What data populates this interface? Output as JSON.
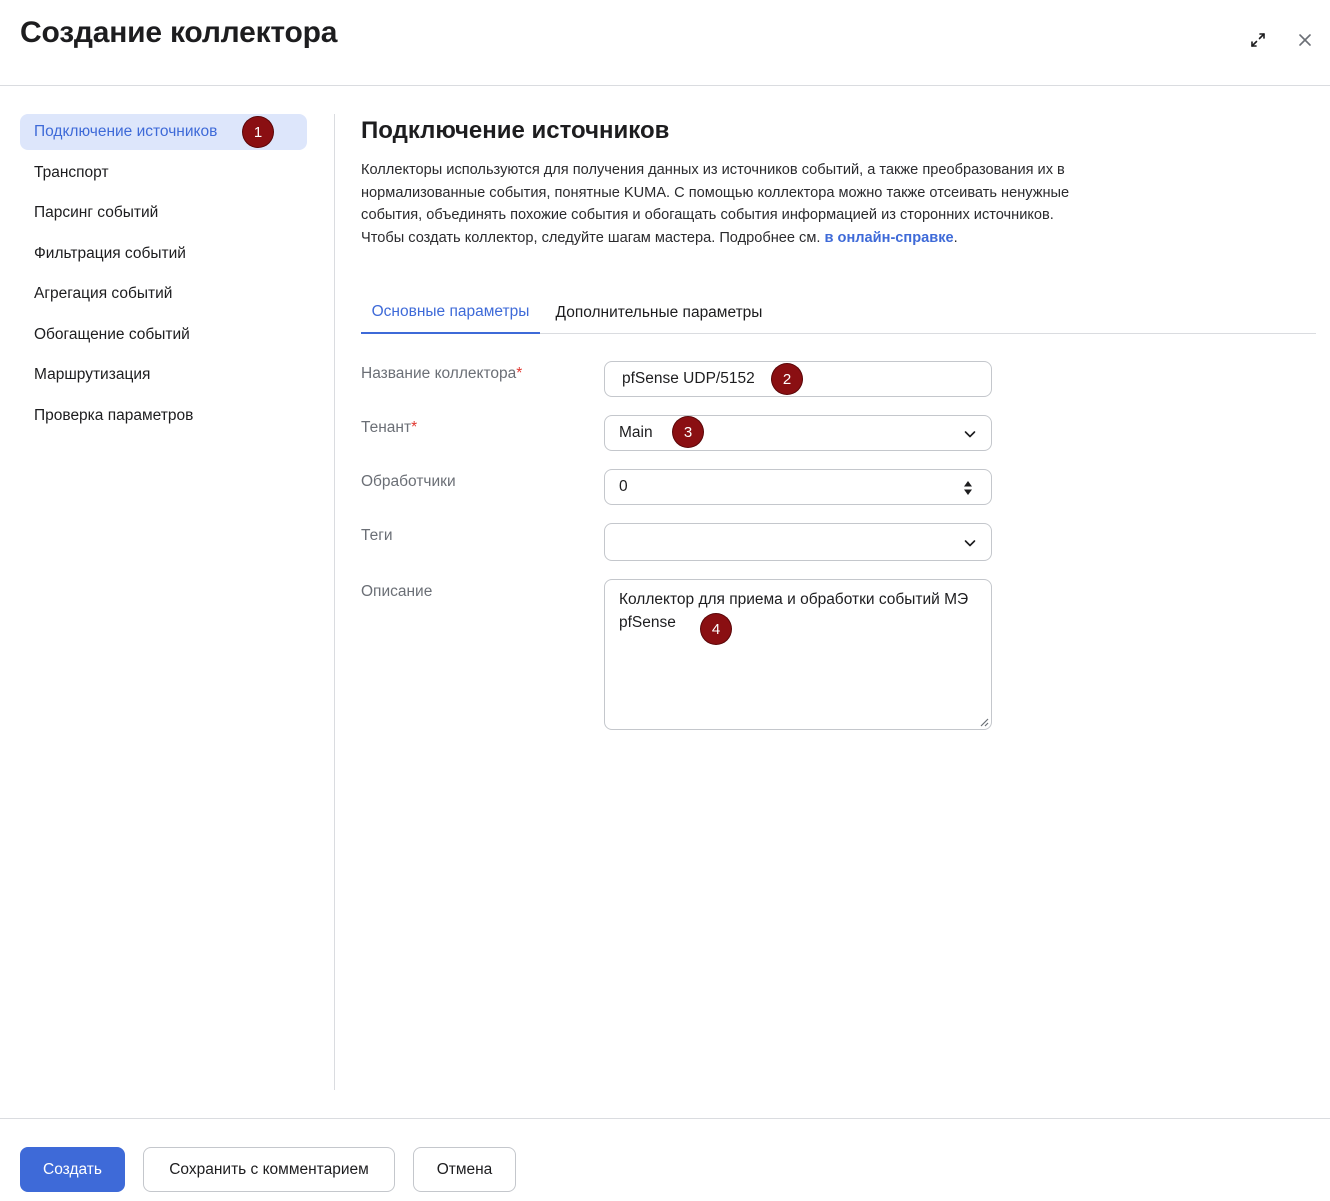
{
  "header": {
    "title": "Создание коллектора",
    "expand_icon": "expand-arrows-icon",
    "close_icon": "close-icon"
  },
  "sidebar": {
    "items": [
      {
        "label": "Подключение источников",
        "active": true
      },
      {
        "label": "Транспорт"
      },
      {
        "label": "Парсинг событий"
      },
      {
        "label": "Фильтрация событий"
      },
      {
        "label": "Агрегация событий"
      },
      {
        "label": "Обогащение событий"
      },
      {
        "label": "Маршрутизация"
      },
      {
        "label": "Проверка параметров"
      }
    ]
  },
  "main": {
    "section_title": "Подключение источников",
    "description": "Коллекторы используются для получения данных из источников событий, а также преобразования их в нормализованные события, понятные KUMA. С помощью коллектора можно также отсеивать ненужные события, объединять похожие события и обогащать события информацией из сторонних источников. Чтобы создать коллектор, следуйте шагам мастера. Подробнее см.",
    "description_link": "в онлайн-справке",
    "description_end": ".",
    "tabs": [
      {
        "label": "Основные параметры",
        "active": true
      },
      {
        "label": "Дополнительные параметры"
      }
    ]
  },
  "form": {
    "name": {
      "label": "Название коллектора",
      "required": "*",
      "value": "pfSense UDP/5152"
    },
    "tenant": {
      "label": "Тенант",
      "required": "*",
      "value": "Main"
    },
    "handlers": {
      "label": "Обработчики",
      "value": "0"
    },
    "tags": {
      "label": "Теги",
      "value": ""
    },
    "description": {
      "label": "Описание",
      "value": "Коллектор для приема и обработки событий МЭ pfSense"
    }
  },
  "annotations": [
    "1",
    "2",
    "3",
    "4"
  ],
  "footer": {
    "create": "Создать",
    "save_with_comment": "Сохранить с комментарием",
    "cancel": "Отмена"
  },
  "colors": {
    "accent": "#3e6ad8",
    "active_bg": "#dde6fb",
    "badge": "#8a0f12",
    "required": "#e0362f"
  }
}
